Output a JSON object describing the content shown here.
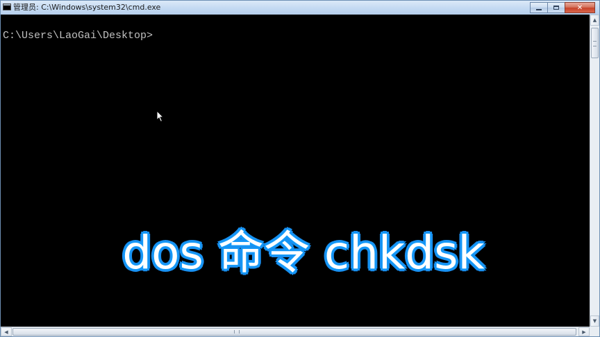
{
  "window": {
    "title": "管理员: C:\\Windows\\system32\\cmd.exe",
    "icon": "cmd-icon",
    "buttons": {
      "minimize_icon": "minimize-icon",
      "maximize_icon": "maximize-icon",
      "close_icon": "close-icon",
      "close_label": "✕"
    }
  },
  "console": {
    "prompt": "C:\\Users\\LaoGai\\Desktop>",
    "background": "#000000",
    "text_color": "#c0c0c0"
  },
  "overlay": {
    "caption": "dos 命令 chkdsk",
    "fill_color": "#ffffff",
    "outline_color": "#1596f5"
  },
  "scrollbars": {
    "up_arrow": "▲",
    "down_arrow": "▼",
    "left_arrow": "◀",
    "right_arrow": "▶"
  }
}
